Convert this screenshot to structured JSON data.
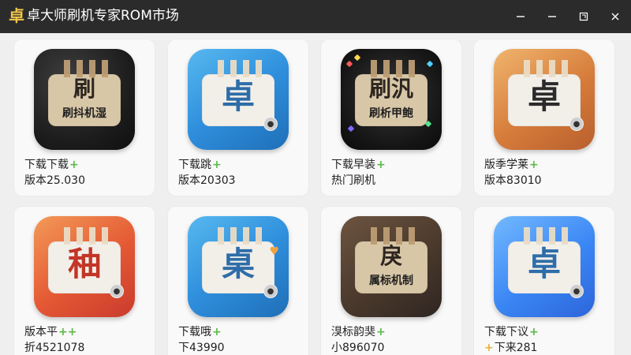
{
  "window": {
    "title": "卓大师刷机专家ROM市场",
    "app_icon_glyph": "卓",
    "controls": {
      "minimize": "minimize-icon",
      "maximize": "maximize-icon",
      "restore": "restore-icon",
      "close": "close-icon"
    }
  },
  "colors": {
    "accent": "#5db84a",
    "secondary_accent": "#e7b23f",
    "window_bar": "#2b2b2b",
    "surface": "#f9f9f9"
  },
  "cards": [
    {
      "theme": "dark",
      "glyph": "刷",
      "subglyph": "刷抖机湿",
      "line1": "下载下载+",
      "line2": "版本25.030",
      "icon_name": "app-icon-flash-dark"
    },
    {
      "theme": "blue",
      "glyph": "卓",
      "subglyph": "",
      "line1": "下载跳+",
      "line2": "版本20303",
      "icon_name": "app-icon-zhuo-blue"
    },
    {
      "theme": "multi",
      "glyph": "刷汎",
      "subglyph": "刷析甲鲍",
      "line1": "下载早装+",
      "line2": "热门刷机",
      "icon_name": "app-icon-flash-black"
    },
    {
      "theme": "orange",
      "glyph": "卓",
      "subglyph": "",
      "line1": "版季学莱+",
      "line2": "版本83010",
      "icon_name": "app-icon-zhuo-orange"
    },
    {
      "theme": "red",
      "glyph": "秞",
      "subglyph": "",
      "line1": "版本平++",
      "line2": "折4521078",
      "icon_name": "app-icon-red"
    },
    {
      "theme": "blue",
      "glyph": "桌",
      "subglyph": "",
      "line1": "下载哦+",
      "line2": "下43990",
      "icon_name": "app-icon-zhuo-blue-heart"
    },
    {
      "theme": "brown",
      "glyph": "戾",
      "subglyph": "属标机制",
      "line1": "湨标韵猆+",
      "line2": "小896070",
      "icon_name": "app-icon-brown"
    },
    {
      "theme": "sky",
      "glyph": "卓",
      "subglyph": "",
      "line1": "下载下议+",
      "line2": "下来281",
      "icon_name": "app-icon-zhuo-sky"
    }
  ]
}
